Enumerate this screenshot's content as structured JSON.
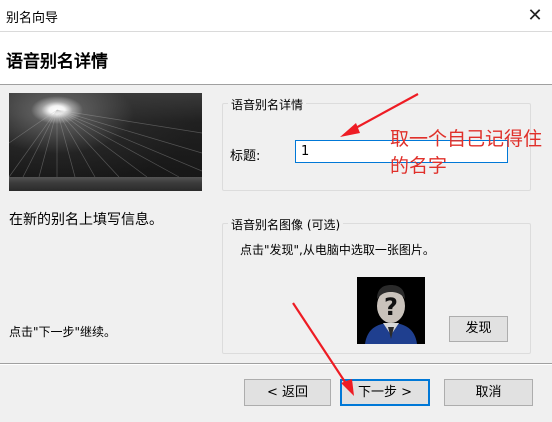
{
  "window": {
    "title": "别名向导",
    "close_glyph": "✕"
  },
  "header": {
    "title": "语音别名详情"
  },
  "left_panel": {
    "instruction": "在新的别名上填写信息。",
    "next_hint": "点击\"下一步\"继续。"
  },
  "details_group": {
    "legend": "语音别名详情",
    "title_label": "标题:",
    "title_value": "1"
  },
  "image_group": {
    "legend": "语音别名图像 (可选)",
    "hint": "点击\"发现\",从电脑中选取一张图片。",
    "discover_button": "发现"
  },
  "footer": {
    "back_button": "< 返回",
    "next_button": "下一步 >",
    "cancel_button": "取消"
  },
  "annotation": {
    "text": "取一个自己记得住的名字",
    "color": "#e0302a"
  },
  "icons": {
    "close": "close-icon",
    "avatar": "unknown-person-avatar"
  }
}
